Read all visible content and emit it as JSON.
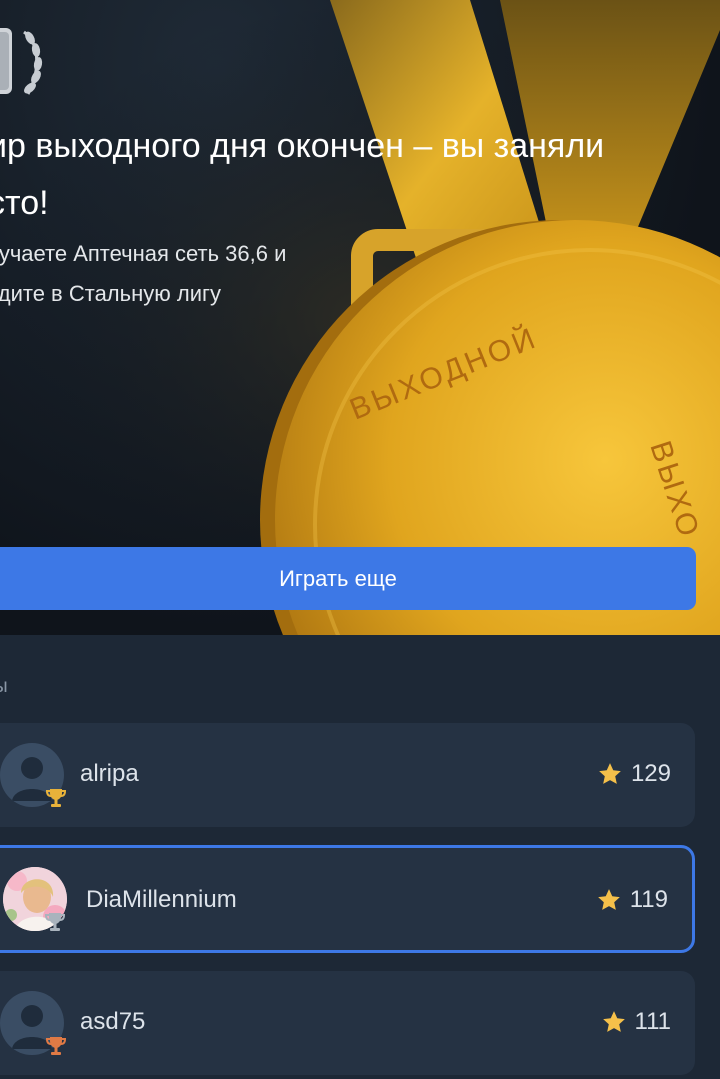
{
  "hero": {
    "title": "ир выходного дня окончен – вы заняли сто!",
    "subtitle": "лучаете Аптечная сеть 36,6 и одите в Стальную лигу",
    "medal_text_main": "ВЫХОДНОЙ",
    "medal_text_side": "ВЫХО",
    "button_label": "Играть еще"
  },
  "leaderboard": {
    "section_label": "ы",
    "rows": [
      {
        "name": "alripa",
        "score": "129",
        "cup": "gold-cup-icon",
        "cup_color": "#e8b23a",
        "avatar": "default-avatar",
        "active": false
      },
      {
        "name": "DiaMillennium",
        "score": "119",
        "cup": "silver-cup-icon",
        "cup_color": "#a9b3bd",
        "avatar": "photo-avatar",
        "active": true
      },
      {
        "name": "asd75",
        "score": "111",
        "cup": "bronze-cup-icon",
        "cup_color": "#e07a45",
        "avatar": "default-avatar",
        "active": false
      }
    ]
  },
  "colors": {
    "accent": "#3d78e6",
    "star": "#f5c04a",
    "row_bg": "#253243",
    "page_bg": "#1d2836"
  }
}
